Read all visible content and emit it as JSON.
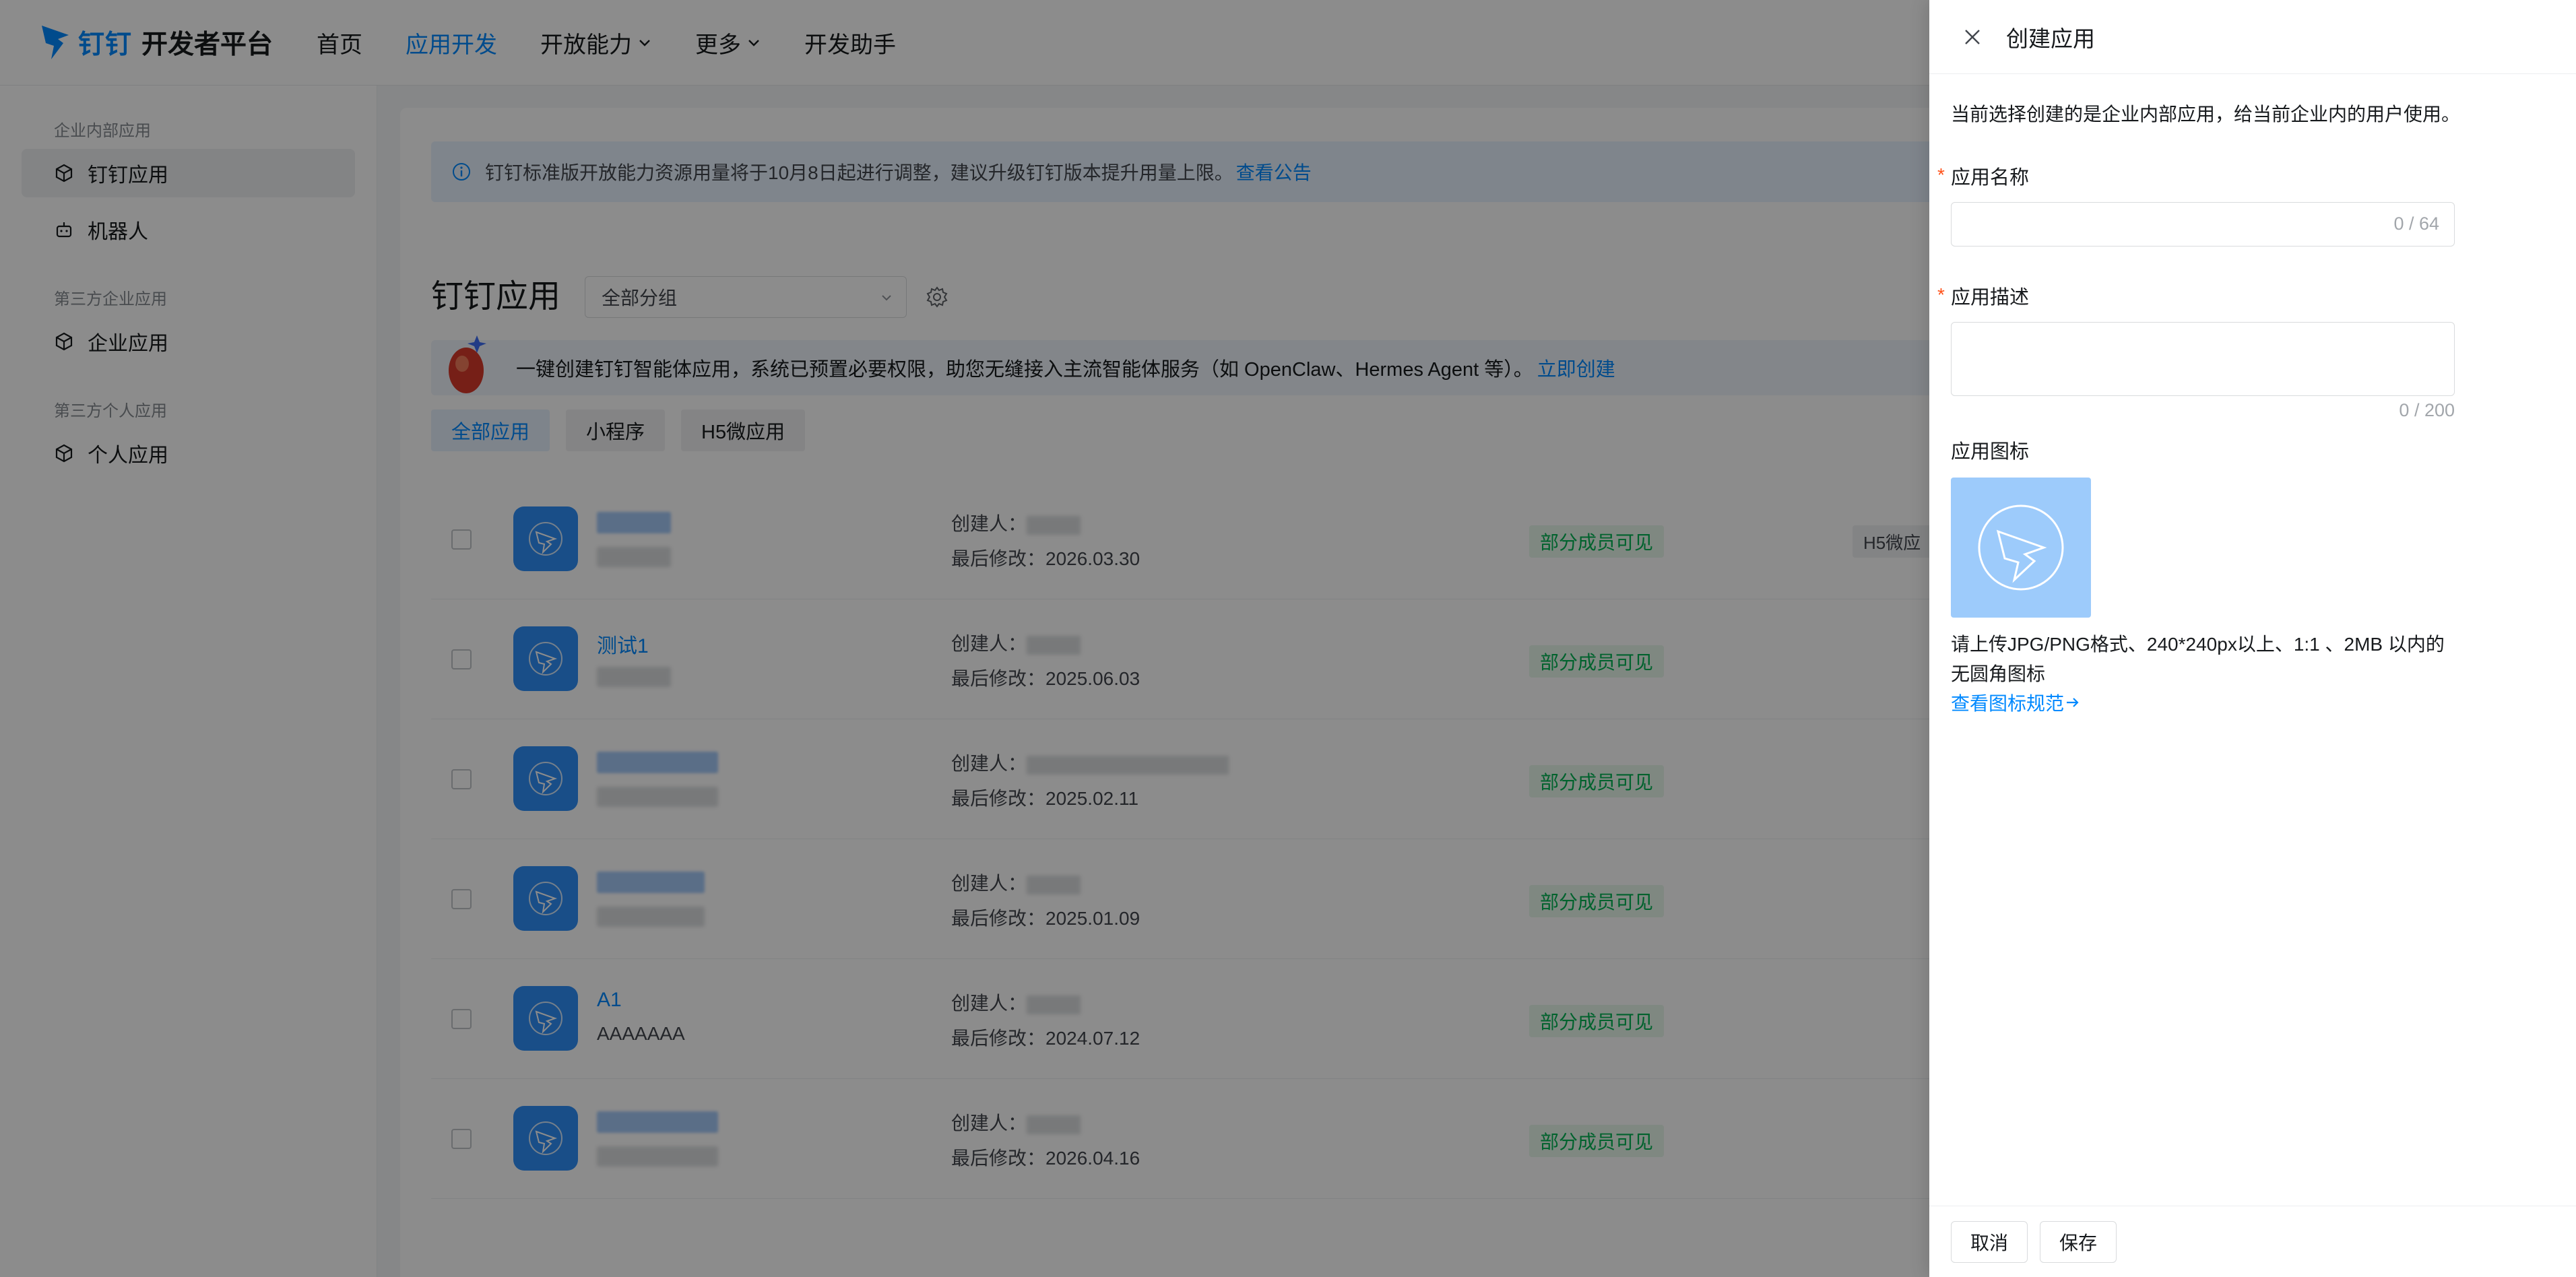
{
  "header": {
    "logo_brand": "钉钉",
    "logo_sub": "开发者平台",
    "nav": [
      {
        "label": "首页",
        "active": false
      },
      {
        "label": "应用开发",
        "active": true
      },
      {
        "label": "开放能力",
        "active": false,
        "dropdown": true
      },
      {
        "label": "更多",
        "active": false,
        "dropdown": true
      },
      {
        "label": "开发助手",
        "active": false
      }
    ]
  },
  "sidebar": {
    "group1": "企业内部应用",
    "item_dingtalk_app": "钉钉应用",
    "item_robot": "机器人",
    "group2": "第三方企业应用",
    "item_enterprise_app": "企业应用",
    "group3": "第三方个人应用",
    "item_personal_app": "个人应用"
  },
  "main": {
    "notice_text": "钉钉标准版开放能力资源用量将于10月8日起进行调整，建议升级钉钉版本提升用量上限。",
    "notice_link": "查看公告",
    "section_title": "钉钉应用",
    "group_select": "全部分组",
    "banner_text": "一键创建钉钉智能体应用，系统已预置必要权限，助您无缝接入主流智能体服务（如 OpenClaw、Hermes Agent 等）。",
    "banner_link": "立即创建",
    "filters": [
      "全部应用",
      "小程序",
      "H5微应用"
    ],
    "creator_label": "创建人：",
    "modified_label": "最后修改：",
    "visibility_badge": "部分成员可见",
    "type_chip": "H5微应",
    "rows": [
      {
        "name": "",
        "desc": "",
        "date": "2026.03.30",
        "show_type": true
      },
      {
        "name": "测试1",
        "desc": "",
        "date": "2025.06.03",
        "show_type": false
      },
      {
        "name": "",
        "desc": "",
        "date": "2025.02.11",
        "show_type": false
      },
      {
        "name": "",
        "desc": "",
        "date": "2025.01.09",
        "show_type": false
      },
      {
        "name": "A1",
        "desc": "AAAAAAA",
        "date": "2024.07.12",
        "show_type": false
      },
      {
        "name": "",
        "desc": "",
        "date": "2026.04.16",
        "show_type": false
      }
    ]
  },
  "drawer": {
    "title": "创建应用",
    "intro": "当前选择创建的是企业内部应用，给当前企业内的用户使用。",
    "name_label": "应用名称",
    "name_value": "",
    "name_counter": "0 / 64",
    "desc_label": "应用描述",
    "desc_value": "",
    "desc_counter": "0 / 200",
    "icon_label": "应用图标",
    "icon_hint": "请上传JPG/PNG格式、240*240px以上、1:1 、2MB 以内的无圆角图标",
    "icon_link": "查看图标规范",
    "cancel": "取消",
    "save": "保存"
  },
  "colors": {
    "accent": "#0089ff",
    "success": "#00b353",
    "required": "#ff5219"
  }
}
